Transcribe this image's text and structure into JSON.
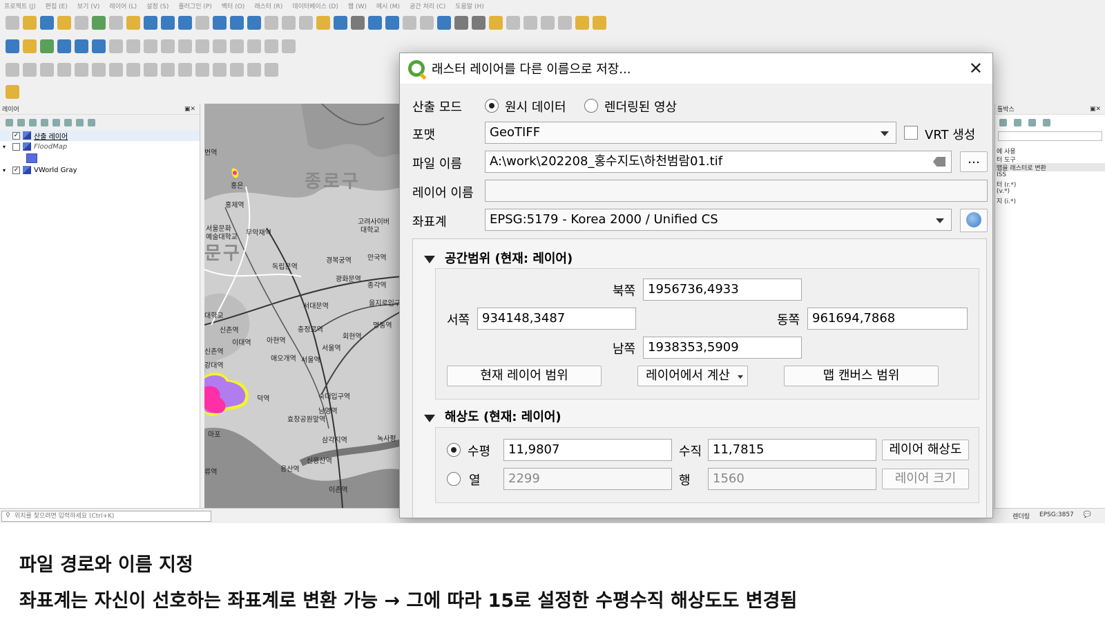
{
  "menu": [
    "프로젝트 (J)",
    "편집 (E)",
    "보기 (V)",
    "레이어 (L)",
    "설정 (S)",
    "플러그인 (P)",
    "벡터 (O)",
    "래스터 (R)",
    "데이터베이스 (D)",
    "웹 (W)",
    "메시 (M)",
    "공간 처리 (C)",
    "도움말 (H)"
  ],
  "layers_panel": {
    "title": "레이어",
    "items": [
      {
        "name": "산출 레이어",
        "checked": true
      },
      {
        "name": "FloodMap",
        "checked": false
      },
      {
        "name": "VWorld Gray",
        "checked": true
      }
    ]
  },
  "toolbox_panel": {
    "title": "툴박스",
    "items": [
      "에 사용",
      "터 도구",
      "맵을 래스터로 변환",
      "ISS",
      "터 (r.*)",
      "(v.*)",
      "지 (i.*)"
    ]
  },
  "map_labels": {
    "big1": "종로구",
    "big2": "문구",
    "stations": [
      "번역",
      "홍은",
      "홍제역",
      "서울문화",
      "예술대학교",
      "무악재역",
      "고려사이버",
      "대학교",
      "독립문역",
      "경복궁역",
      "안국역",
      "광화문역",
      "종각역",
      "대학교",
      "신촌역",
      "이대역",
      "아현역",
      "충정로역",
      "서대문역",
      "을지로입구역",
      "명동역",
      "회현역",
      "서울역",
      "신촌역",
      "강대역",
      "애오개역",
      "서울역",
      "덕역",
      "숙대입구역",
      "효창공원앞역",
      "남영역",
      "마포",
      "삼각지역",
      "녹사평",
      "신용산역",
      "용산역",
      "이촌역",
      "류역"
    ]
  },
  "statusbar": {
    "locator_placeholder": "위치를 찾으려면 입력하세요 (Ctrl+K)",
    "render": "렌더링",
    "crs": "EPSG:3857"
  },
  "dialog": {
    "title": "래스터 레이어를 다른 이름으로 저장...",
    "output_mode_label": "산출 모드",
    "mode_raw": "원시 데이터",
    "mode_rendered": "렌더링된 영상",
    "format_label": "포맷",
    "format_value": "GeoTIFF",
    "vrt_label": "VRT 생성",
    "filename_label": "파일 이름",
    "filename_value": "A:\\work\\202208_홍수지도\\하천범람01.tif",
    "layername_label": "레이어 이름",
    "layername_value": "",
    "crs_label": "좌표계",
    "crs_value": "EPSG:5179 - Korea 2000 / Unified CS",
    "extent": {
      "header": "공간범위 (현재: 레이어)",
      "north_label": "북쪽",
      "north": "1956736,4933",
      "west_label": "서쪽",
      "west": "934148,3487",
      "east_label": "동쪽",
      "east": "961694,7868",
      "south_label": "남쪽",
      "south": "1938353,5909",
      "btn_current": "현재 레이어 범위",
      "btn_calc": "레이어에서 계산",
      "btn_canvas": "맵 캔버스 범위"
    },
    "resolution": {
      "header": "해상도 (현재: 레이어)",
      "horiz_label": "수평",
      "horiz": "11,9807",
      "vert_label": "수직",
      "vert": "11,7815",
      "btn_res": "레이어 해상도",
      "cols_label": "열",
      "cols": "2299",
      "rows_label": "행",
      "rows": "1560",
      "btn_size": "레이어 크기"
    }
  },
  "caption": {
    "line1": "파일 경로와 이름 지정",
    "line2": "좌표계는 자신이 선호하는 좌표계로 변환 가능 → 그에 따라 15로 설정한 수평수직 해상도도 변경됨"
  },
  "colors": {
    "qgis_green": "#52a33a",
    "flood_magenta": "#ff2fa8",
    "flood_violet": "#b07cf0",
    "flood_yellow": "#f6f22a"
  }
}
